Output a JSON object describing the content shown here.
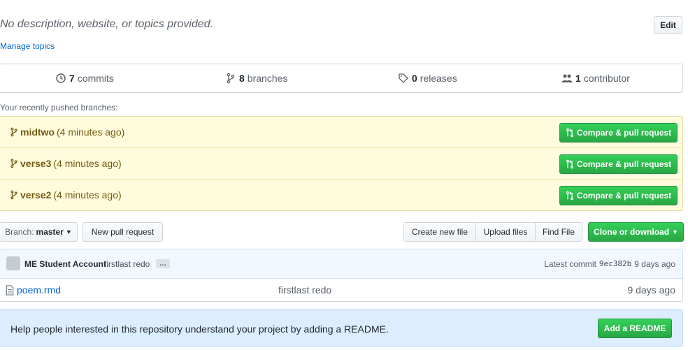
{
  "repo": {
    "description": "No description, website, or topics provided.",
    "edit_label": "Edit",
    "manage_topics": "Manage topics"
  },
  "summary": {
    "commits_count": "7",
    "commits_label": "commits",
    "branches_count": "8",
    "branches_label": "branches",
    "releases_count": "0",
    "releases_label": "releases",
    "contributors_count": "1",
    "contributors_label": "contributor"
  },
  "recent": {
    "label": "Your recently pushed branches:",
    "compare_label": "Compare & pull request",
    "branches": [
      {
        "name": "midtwo",
        "age": "(4 minutes ago)"
      },
      {
        "name": "verse3",
        "age": "(4 minutes ago)"
      },
      {
        "name": "verse2",
        "age": "(4 minutes ago)"
      }
    ]
  },
  "toolbar": {
    "branch_prefix": "Branch:",
    "branch_value": "master",
    "new_pr": "New pull request",
    "create_file": "Create new file",
    "upload_files": "Upload files",
    "find_file": "Find File",
    "clone": "Clone or download"
  },
  "commit": {
    "author": "ME Student Account",
    "message": "firstlast redo",
    "ellipsis": "…",
    "latest_label": "Latest commit",
    "sha": "9ec382b",
    "age": "9 days ago"
  },
  "files": [
    {
      "name": "poem.rmd",
      "commit_message": "firstlast redo",
      "age": "9 days ago"
    }
  ],
  "readme": {
    "text": "Help people interested in this repository understand your project by adding a README.",
    "button": "Add a README"
  },
  "colors": {
    "link": "#0366d6",
    "green": "#28a745",
    "recent_bg": "#fffbdd",
    "commit_bg": "#f1f8ff",
    "readme_bg": "#dbedff"
  }
}
